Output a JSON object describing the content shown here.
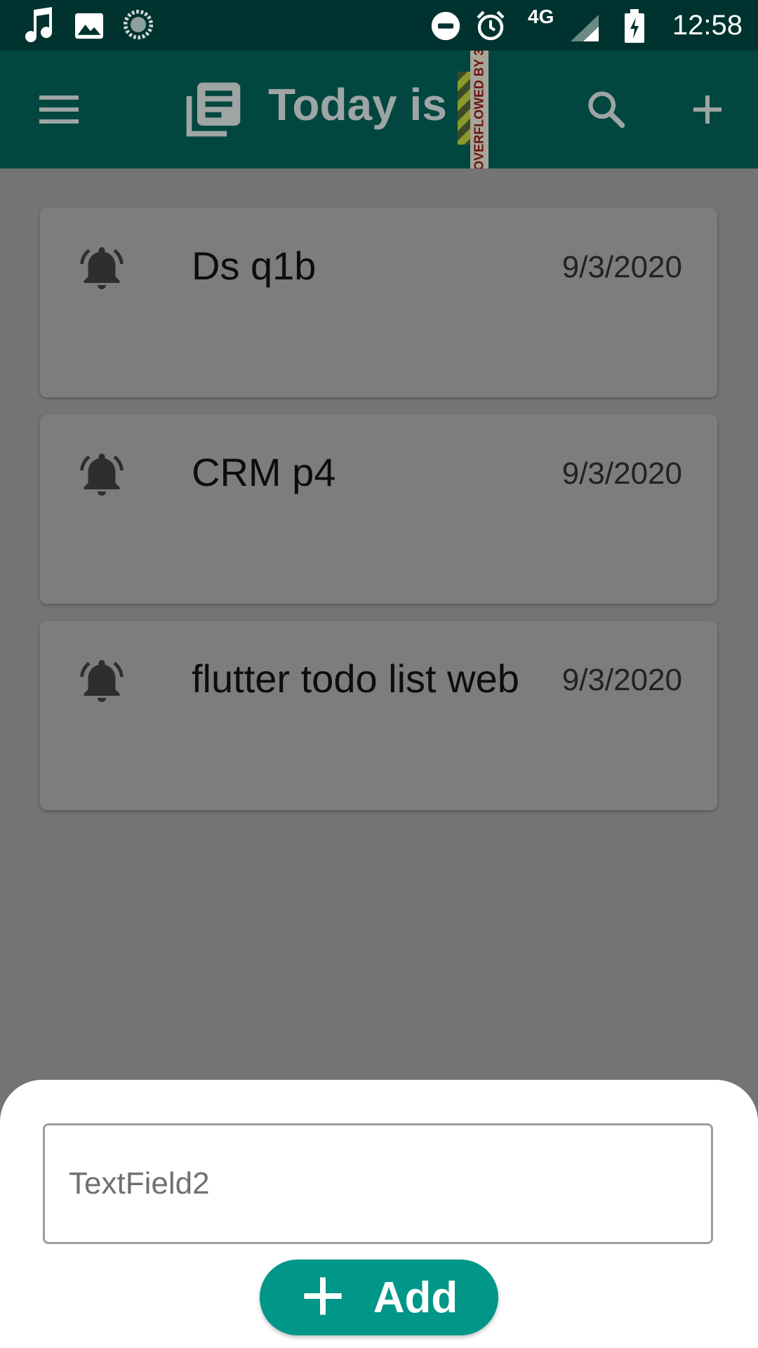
{
  "status_bar": {
    "network": "4G",
    "time": "12:58",
    "icons": [
      "music-note-icon",
      "image-icon",
      "sync-icon",
      "do-not-disturb-icon",
      "alarm-icon",
      "signal-icon",
      "battery-charging-icon"
    ]
  },
  "app_bar": {
    "title": "Today is",
    "overflow_banner": "OVERFLOWED BY 3",
    "background": "#014740",
    "icons": [
      "menu-icon",
      "news-icon",
      "search-icon",
      "add-icon"
    ]
  },
  "tasks": [
    {
      "title": "Ds q1b",
      "date": "9/3/2020"
    },
    {
      "title": "CRM p4",
      "date": "9/3/2020"
    },
    {
      "title": "flutter todo list web",
      "date": "9/3/2020"
    }
  ],
  "sheet": {
    "input_placeholder": "TextField2",
    "input_value": "",
    "add_label": "Add",
    "accent": "#009688"
  }
}
